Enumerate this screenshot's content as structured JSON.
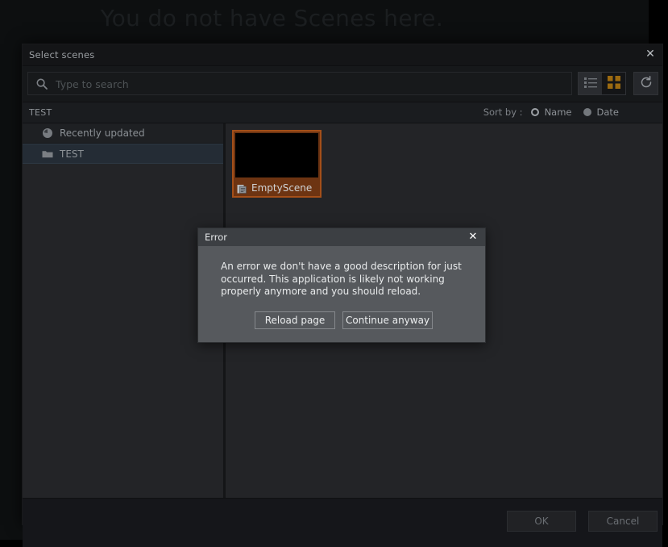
{
  "background": {
    "empty_state_text": "You do not have Scenes here."
  },
  "panel": {
    "title": "Select scenes",
    "close_icon": "close-icon",
    "search": {
      "placeholder": "Type to search",
      "value": "",
      "icon": "search-icon"
    },
    "view_toggle": {
      "list_icon": "list-view-icon",
      "grid_icon": "grid-view-icon",
      "active": "grid"
    },
    "refresh_icon": "refresh-icon",
    "breadcrumb": "TEST",
    "sort": {
      "label": "Sort by :",
      "options": [
        {
          "label": "Name",
          "state": "ring"
        },
        {
          "label": "Date",
          "state": "filled"
        }
      ]
    },
    "tree": {
      "items": [
        {
          "label": "Recently updated",
          "icon": "clock-icon",
          "selected": false
        },
        {
          "label": "TEST",
          "icon": "folder-icon",
          "selected": true
        }
      ]
    },
    "scenes": [
      {
        "label": "EmptyScene",
        "icon": "scene-file-icon"
      }
    ],
    "footer": {
      "ok_label": "OK",
      "cancel_label": "Cancel"
    }
  },
  "error_dialog": {
    "title": "Error",
    "close_icon": "close-icon",
    "message": "An error we don't have a good description for just occurred. This application is likely not working properly anymore and you should reload.",
    "reload_label": "Reload page",
    "continue_label": "Continue anyway"
  },
  "colors": {
    "accent_orange": "#a44f19",
    "grid_icon_orange": "#9c6a10",
    "panel_bg": "#232427",
    "titlebar_bg": "#141517",
    "selection_blue": "#242c35",
    "dialog_bg": "#56595d"
  }
}
